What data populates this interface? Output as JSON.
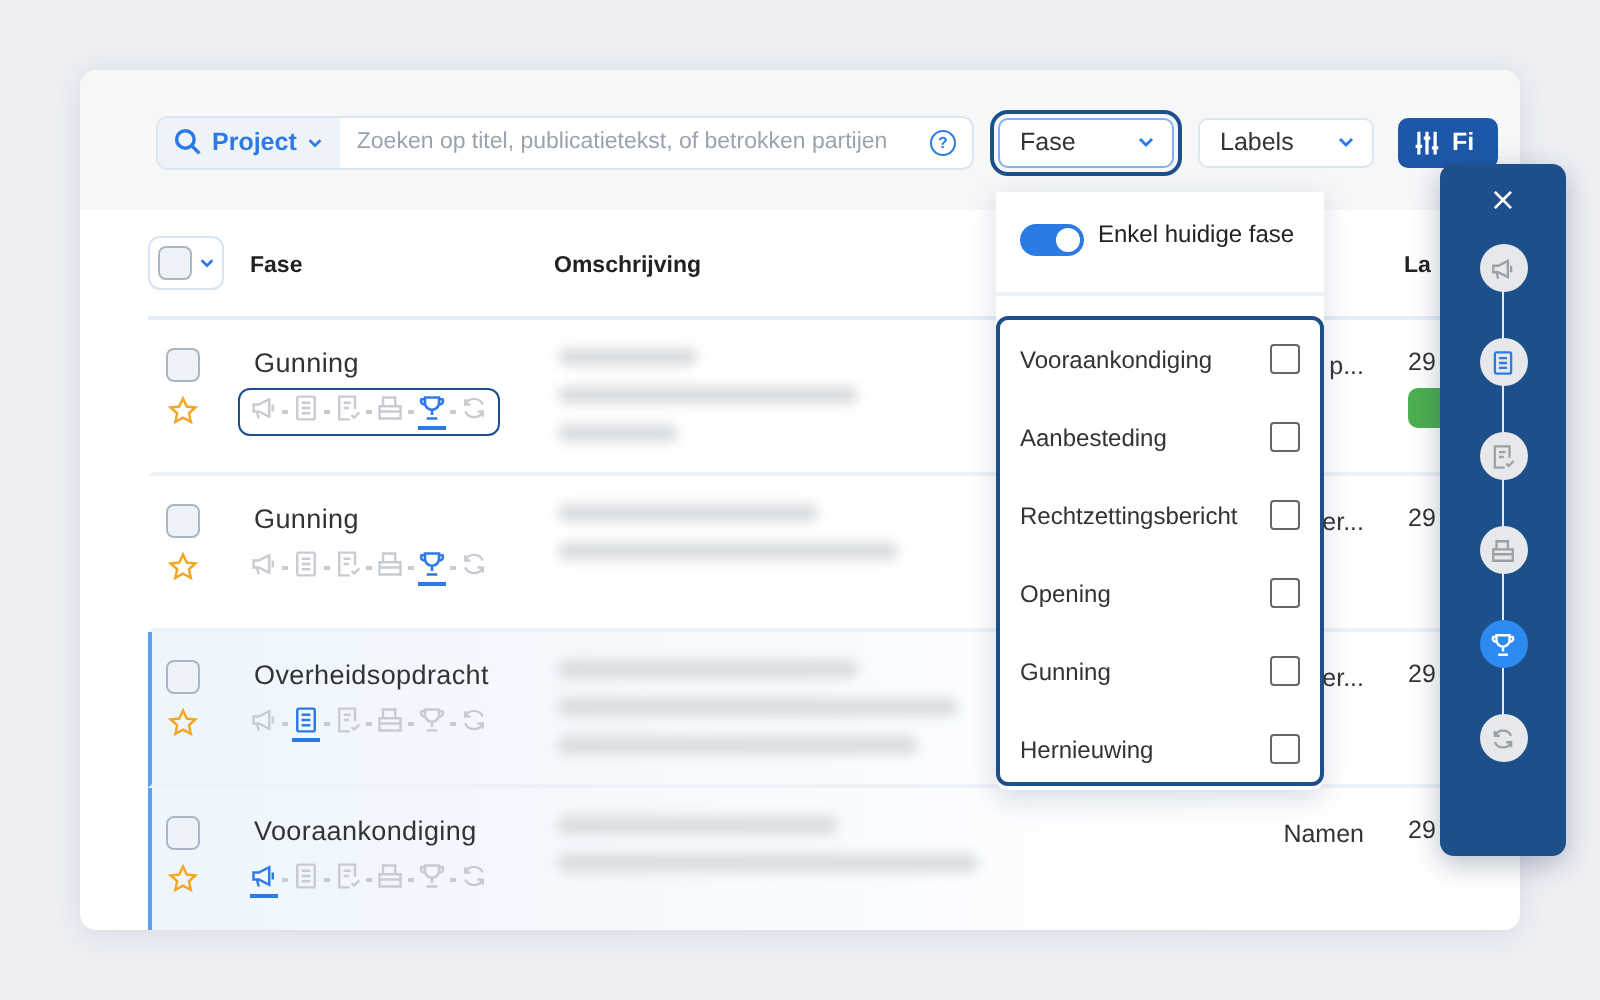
{
  "search": {
    "scope": "Project",
    "placeholder": "Zoeken op titel, publicatietekst, of betrokken partijen",
    "help": "?"
  },
  "filters": [
    {
      "label": "Fase",
      "focused": true
    },
    {
      "label": "Labels",
      "focused": false
    }
  ],
  "filter_button": {
    "label": "Fi"
  },
  "table": {
    "select_all": {
      "checked": false
    },
    "columns": [
      "Fase",
      "Omschrijving",
      "La"
    ],
    "rows": [
      {
        "phase": "Gunning",
        "favorite": false,
        "selected": false,
        "steps_focused": true,
        "column_4": "p...",
        "date": "29",
        "status_tag": {
          "color": "#4caf50"
        },
        "steps": [
          {
            "kind": "megaphone",
            "current": false
          },
          {
            "kind": "document",
            "current": false
          },
          {
            "kind": "checklist",
            "current": false
          },
          {
            "kind": "tray",
            "current": false
          },
          {
            "kind": "trophy",
            "current": true
          },
          {
            "kind": "refresh",
            "current": false
          }
        ]
      },
      {
        "phase": "Gunning",
        "favorite": false,
        "selected": false,
        "steps_focused": false,
        "column_4": "er...",
        "date": "29",
        "steps": [
          {
            "kind": "megaphone",
            "current": false
          },
          {
            "kind": "document",
            "current": false
          },
          {
            "kind": "checklist",
            "current": false
          },
          {
            "kind": "tray",
            "current": false
          },
          {
            "kind": "trophy",
            "current": true
          },
          {
            "kind": "refresh",
            "current": false
          }
        ]
      },
      {
        "phase": "Overheidsopdracht",
        "favorite": false,
        "selected": true,
        "steps_focused": false,
        "column_4": "er...",
        "date": "29",
        "steps": [
          {
            "kind": "megaphone",
            "current": false
          },
          {
            "kind": "document",
            "current": true
          },
          {
            "kind": "checklist",
            "current": false
          },
          {
            "kind": "tray",
            "current": false
          },
          {
            "kind": "trophy",
            "current": false
          },
          {
            "kind": "refresh",
            "current": false
          }
        ]
      },
      {
        "phase": "Vooraankondiging",
        "favorite": false,
        "selected": true,
        "steps_focused": false,
        "column_4": "Namen",
        "date": "29",
        "steps": [
          {
            "kind": "megaphone",
            "current": true
          },
          {
            "kind": "document",
            "current": false
          },
          {
            "kind": "checklist",
            "current": false
          },
          {
            "kind": "tray",
            "current": false
          },
          {
            "kind": "trophy",
            "current": false
          },
          {
            "kind": "refresh",
            "current": false
          }
        ]
      }
    ]
  },
  "phase_dropdown": {
    "toggle": {
      "label": "Enkel huidige fase",
      "on": true
    },
    "options": [
      {
        "label": "Vooraankondiging",
        "checked": false
      },
      {
        "label": "Aanbesteding",
        "checked": false
      },
      {
        "label": "Rechtzettingsbericht",
        "checked": false
      },
      {
        "label": "Opening",
        "checked": false
      },
      {
        "label": "Gunning",
        "checked": false
      },
      {
        "label": "Hernieuwing",
        "checked": false
      }
    ]
  },
  "phase_panel": {
    "close": "×",
    "steps": [
      {
        "kind": "megaphone",
        "selected": false
      },
      {
        "kind": "document",
        "selected": false
      },
      {
        "kind": "checklist",
        "selected": false
      },
      {
        "kind": "tray",
        "selected": false
      },
      {
        "kind": "trophy",
        "selected": true
      },
      {
        "kind": "refresh",
        "selected": false
      }
    ]
  }
}
